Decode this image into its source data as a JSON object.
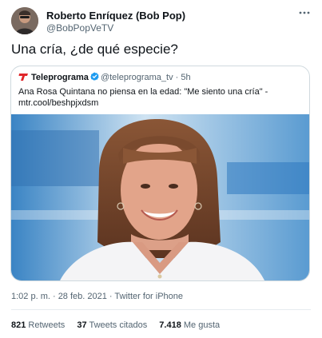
{
  "tweet": {
    "author_name": "Roberto Enríquez (Bob Pop)",
    "author_handle": "@BobPopVeTV",
    "more_icon": "more-horizontal-icon",
    "text": "Una cría, ¿de qué especie?",
    "timestamp": "1:02 p. m. · 28 feb. 2021 · Twitter for iPhone"
  },
  "quoted": {
    "author_name": "Teleprograma",
    "author_handle": "@teleprograma_tv",
    "separator": " · ",
    "age": "5h",
    "text_line1": "Ana Rosa Quintana no piensa en la edad: \"Me siento una cría\" -",
    "text_line2": "mtr.cool/beshpjxdsm",
    "verified_icon": "verified-badge-icon",
    "logo_icon": "teleprograma-logo-icon"
  },
  "stats": {
    "retweets_count": "821",
    "retweets_label": "Retweets",
    "quotes_count": "37",
    "quotes_label": "Tweets citados",
    "likes_count": "7.418",
    "likes_label": "Me gusta"
  },
  "colors": {
    "verified": "#1d9bf0",
    "logo_red": "#e0262a",
    "secondary_text": "#536471",
    "border": "#cfd9de"
  }
}
